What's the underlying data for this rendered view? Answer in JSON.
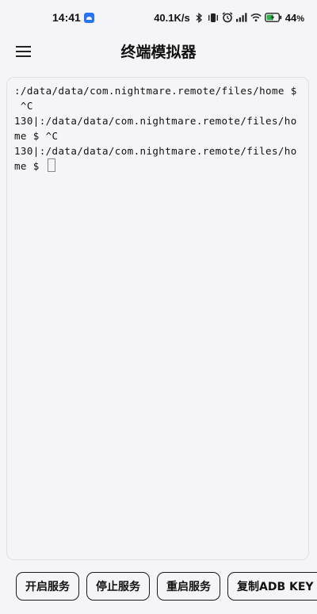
{
  "status_bar": {
    "time": "14:41",
    "network_speed": "40.1K/s",
    "battery_percent": "44",
    "battery_unit": "%",
    "icons": [
      "bluetooth-icon",
      "vibrate-icon",
      "alarm-icon",
      "signal-icon",
      "wifi-icon",
      "battery-charging-icon"
    ]
  },
  "app_bar": {
    "title": "终端模拟器",
    "menu_icon": "hamburger-menu-icon"
  },
  "terminal": {
    "lines": [
      ":/data/data/com.nightmare.remote/files/home $",
      " ^C",
      "130|:/data/data/com.nightmare.remote/files/ho",
      "me $ ^C",
      "130|:/data/data/com.nightmare.remote/files/ho",
      "me $ "
    ]
  },
  "buttons": {
    "start": "开启服务",
    "stop": "停止服务",
    "restart": "重启服务",
    "copy_adb_key": "复制ADB KEY"
  },
  "colors": {
    "background": "#f5f5f8",
    "notification_app": "#2a73f5",
    "battery_charging": "#2bb34a"
  }
}
